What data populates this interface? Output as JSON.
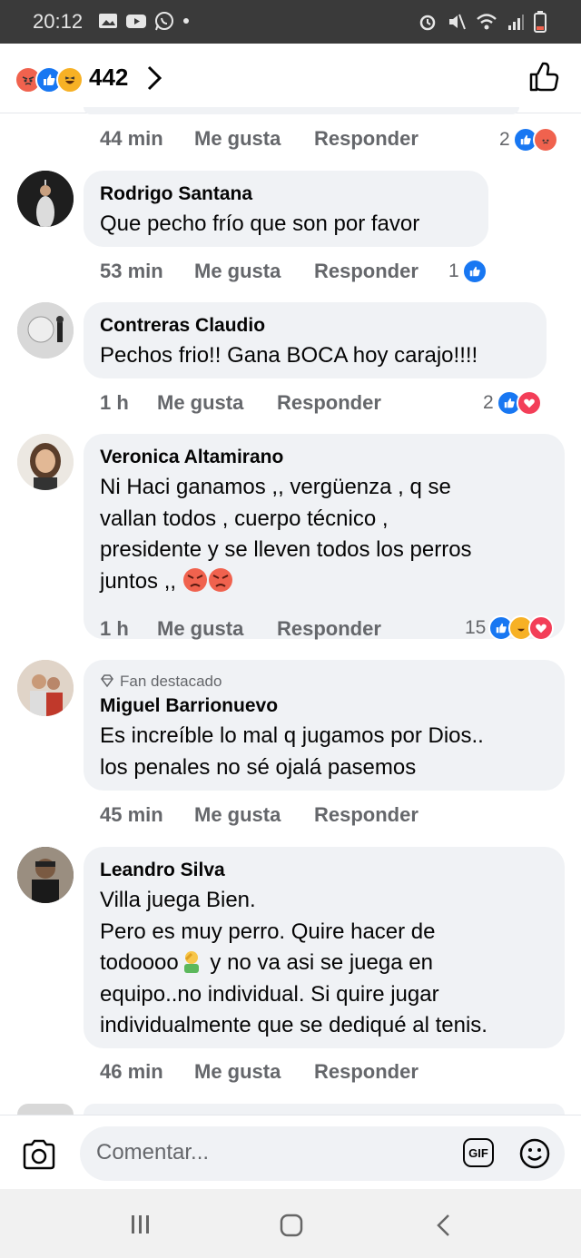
{
  "status_bar": {
    "time": "20:12"
  },
  "header": {
    "reaction_count": "442",
    "reaction_icons": [
      "angry",
      "like",
      "haha"
    ],
    "like_icon": "thumbs-up-outline-icon"
  },
  "comments": [
    {
      "time": "44 min",
      "like_label": "Me gusta",
      "reply_label": "Responder",
      "reactions": "2",
      "reaction_icons": [
        "like",
        "angry"
      ]
    },
    {
      "name": "Rodrigo Santana",
      "text": "Que pecho frío que son por favor",
      "time": "53 min",
      "like_label": "Me gusta",
      "reply_label": "Responder",
      "reactions": "1",
      "reaction_icons": [
        "like"
      ]
    },
    {
      "name": "Contreras Claudio",
      "text": "Pechos frio!! Gana BOCA hoy carajo!!!!",
      "time": "1 h",
      "like_label": "Me gusta",
      "reply_label": "Responder",
      "reactions": "2",
      "reaction_icons": [
        "like",
        "love"
      ]
    },
    {
      "name": "Veronica Altamirano",
      "text": "Ni Haci ganamos ,, vergüenza , q se\nvallan todos , cuerpo técnico ,\npresidente y se lleven todos los perros\njuntos ,,",
      "time": "1 h",
      "like_label": "Me gusta",
      "reply_label": "Responder",
      "reactions": "15",
      "reaction_icons": [
        "like",
        "haha",
        "love"
      ]
    },
    {
      "badge": "Fan destacado",
      "name": "Miguel Barrionuevo",
      "text": "Es increíble lo mal q jugamos por Dios..\nlos penales no sé ojalá pasemos",
      "time": "45 min",
      "like_label": "Me gusta",
      "reply_label": "Responder"
    },
    {
      "name": "Leandro Silva",
      "text_lines": [
        "Villa juega Bien.",
        "Pero es muy perro.  Quire hacer de",
        "todoooo",
        " y no va asi  se juega en",
        "equipo..no individual.  Si quire jugar",
        "individualmente que se dediqué al tenis."
      ],
      "time": "46 min",
      "like_label": "Me gusta",
      "reply_label": "Responder"
    }
  ],
  "composer": {
    "placeholder": "Comentar...",
    "gif_label": "GIF"
  }
}
